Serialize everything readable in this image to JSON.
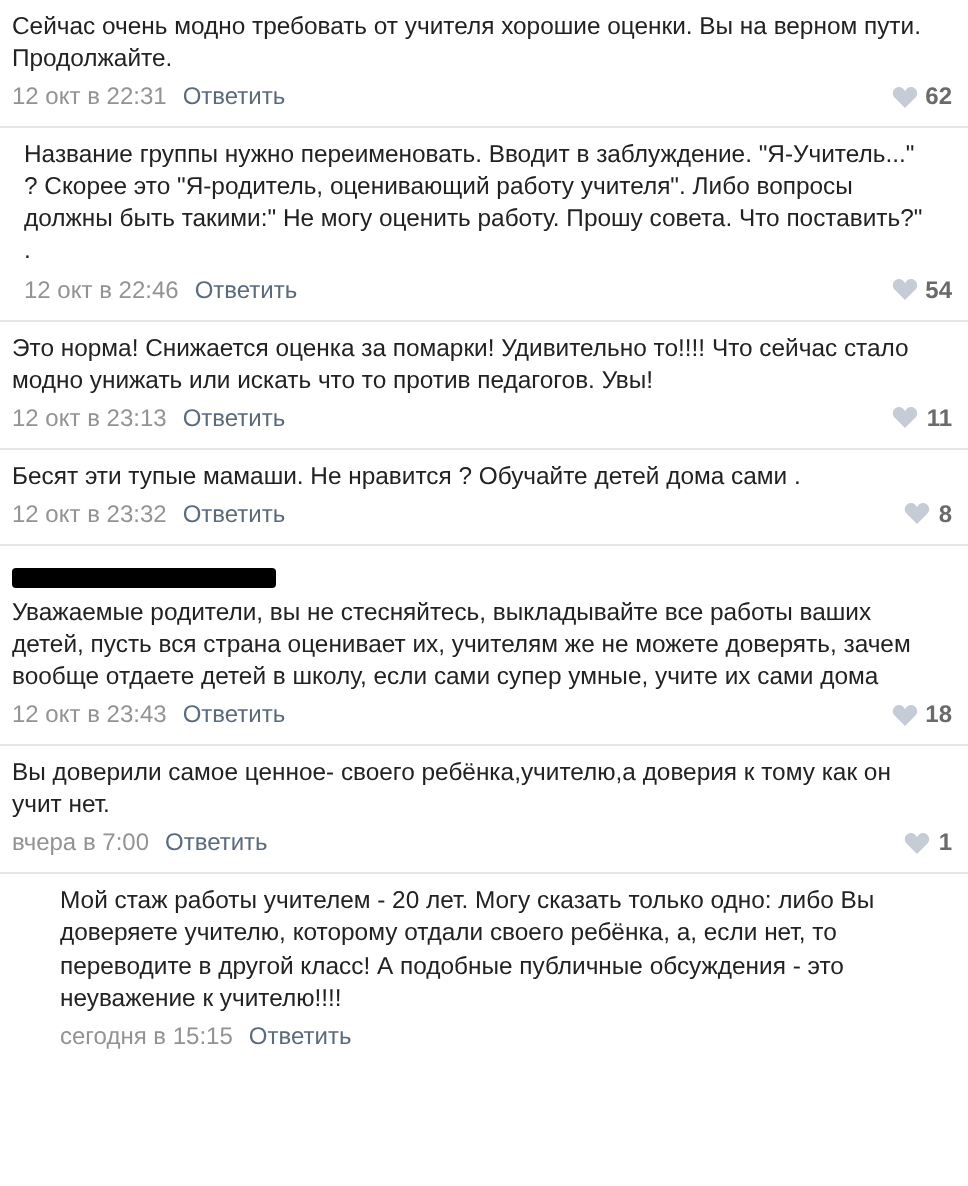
{
  "comments": [
    {
      "text": "Сейчас очень модно требовать от учителя хорошие оценки. Вы на верном пути. Продолжайте.",
      "date": "12 окт в 22:31",
      "reply": "Ответить",
      "likes": "62"
    },
    {
      "text": "Название группы нужно переименовать. Вводит в заблуждение. \"Я-Учитель...\" ? Скорее это \"Я-родитель, оценивающий работу учителя\". Либо вопросы должны быть такими:\" Не могу оценить работу. Прошу совета. Что поставить?\" .",
      "date": "12 окт в 22:46",
      "reply": "Ответить",
      "likes": "54"
    },
    {
      "text": "Это норма! Снижается оценка за помарки! Удивительно то!!!! Что сейчас стало модно унижать или искать что то против педагогов. Увы!",
      "date": "12 окт в 23:13",
      "reply": "Ответить",
      "likes": "11"
    },
    {
      "text": "Бесят эти тупые мамаши. Не нравится ? Обучайте детей дома сами .",
      "date": "12 окт в 23:32",
      "reply": "Ответить",
      "likes": "8"
    },
    {
      "text": "Уважаемые родители, вы не стесняйтесь, выкладывайте все работы ваших детей, пусть вся страна оценивает их, учителям же не можете доверять, зачем вообще отдаете детей в школу, если сами супер умные, учите их сами дома",
      "date": "12 окт в 23:43",
      "reply": "Ответить",
      "likes": "18",
      "redacted_author": true
    },
    {
      "text": "Вы доверили самое ценное- своего ребёнка,учителю,а доверия к тому как он учит нет.",
      "date": "вчера в 7:00",
      "reply": "Ответить",
      "likes": "1"
    },
    {
      "text": "Мой стаж работы учителем - 20 лет. Могу сказать только одно: либо Вы доверяете учителю, которому отдали своего ребёнка, а, если нет, то переводите в другой класс! А подобные публичные обсуждения - это неуважение к учителю!!!!",
      "date": "сегодня в 15:15",
      "reply": "Ответить"
    }
  ]
}
